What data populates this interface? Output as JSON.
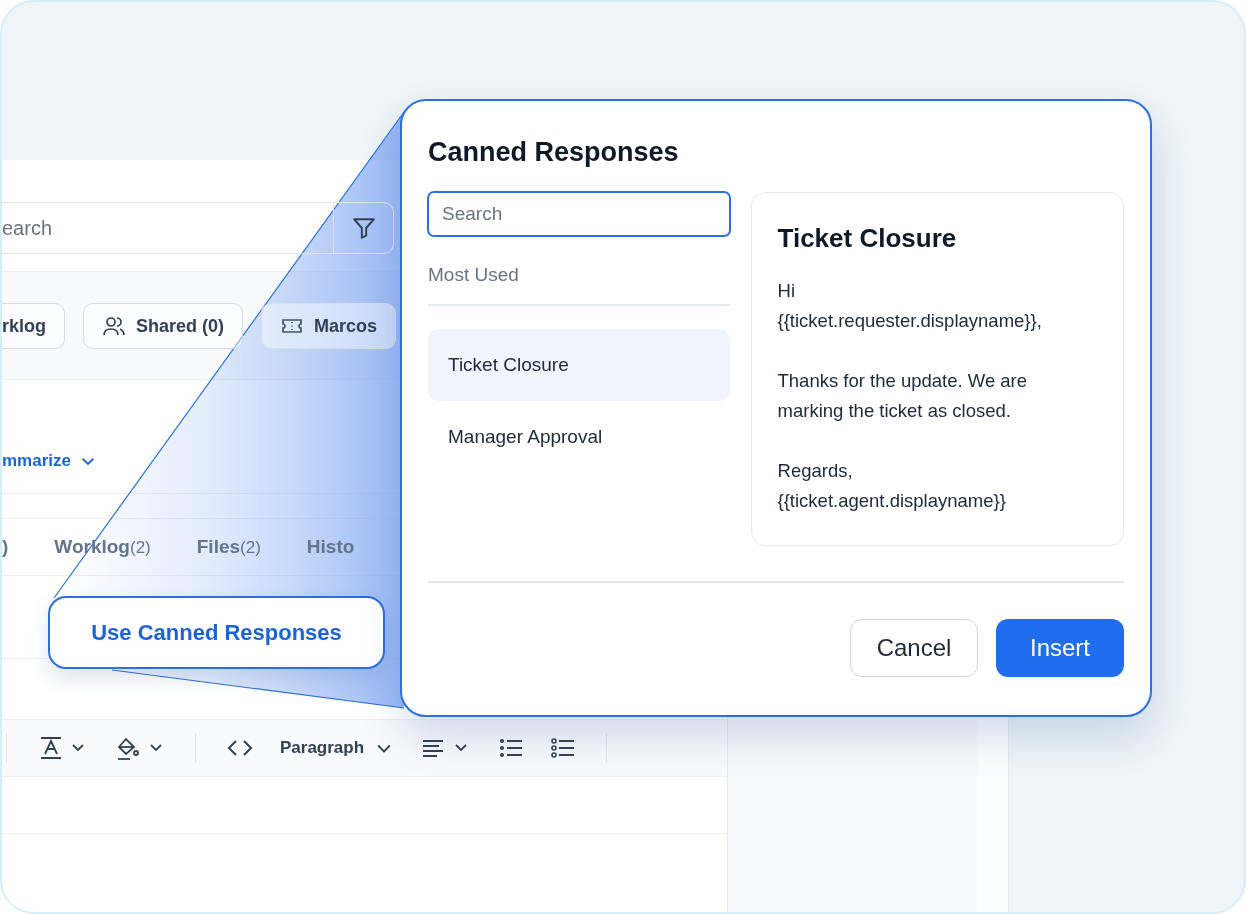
{
  "background_app": {
    "search": {
      "placeholder": "earch"
    },
    "chips": [
      {
        "label": "rklog"
      },
      {
        "label": "Shared (0)"
      },
      {
        "label": "Marcos"
      }
    ],
    "summarize_link": "mmarize",
    "tabs": [
      {
        "label": ")"
      },
      {
        "label": "Worklog",
        "count": "(2)"
      },
      {
        "label": "Files",
        "count": "(2)"
      },
      {
        "label": "Histo"
      }
    ],
    "toolbar": {
      "format_label": "Paragraph"
    }
  },
  "callout": {
    "label": "Use Canned Responses"
  },
  "dialog": {
    "title": "Canned Responses",
    "search": {
      "placeholder": "Search",
      "focused": true
    },
    "section_label": "Most Used",
    "items": [
      {
        "label": "Ticket Closure",
        "selected": true
      },
      {
        "label": "Manager Approval",
        "selected": false
      }
    ],
    "preview": {
      "title": "Ticket Closure",
      "paragraphs": [
        "Hi\n{{ticket.requester.displayname}},",
        "Thanks for the update. We are\nmarking the ticket as closed.",
        "Regards,\n{{ticket.agent.displayname}}"
      ]
    },
    "buttons": {
      "cancel": "Cancel",
      "insert": "Insert"
    }
  }
}
